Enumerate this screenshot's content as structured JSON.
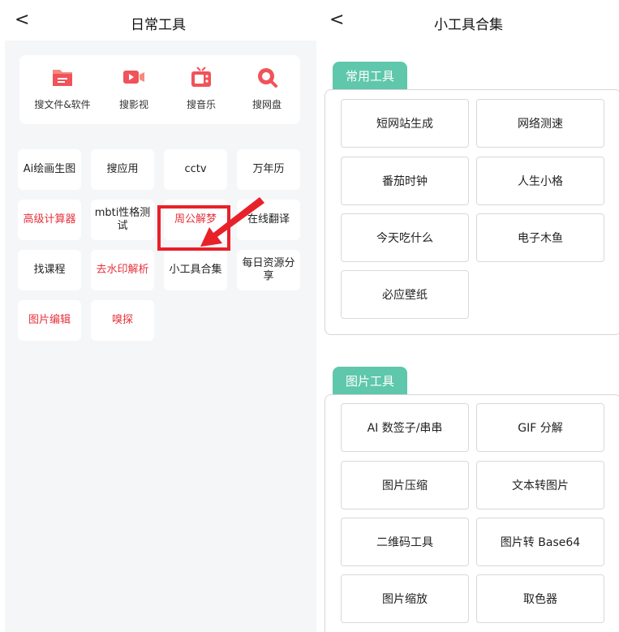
{
  "left": {
    "back": "<",
    "title": "日常工具",
    "search": [
      {
        "label": "搜文件&软件",
        "icon": "folder-icon"
      },
      {
        "label": "搜影视",
        "icon": "video-camera-icon"
      },
      {
        "label": "搜音乐",
        "icon": "tv-icon"
      },
      {
        "label": "搜网盘",
        "icon": "search-magnifier-icon"
      }
    ],
    "tools": [
      {
        "label": "Ai绘画生图"
      },
      {
        "label": "搜应用"
      },
      {
        "label": "cctv"
      },
      {
        "label": "万年历"
      },
      {
        "label": "高级计算器"
      },
      {
        "label": "mbti性格测试"
      },
      {
        "label": "周公解梦"
      },
      {
        "label": "在线翻译"
      },
      {
        "label": "找课程"
      },
      {
        "label": "去水印解析"
      },
      {
        "label": "小工具合集"
      },
      {
        "label": "每日资源分享"
      },
      {
        "label": "图片编辑"
      },
      {
        "label": "嗅探"
      }
    ],
    "highlight_color": "#e8202a"
  },
  "right": {
    "back": "<",
    "title": "小工具合集",
    "sections": [
      {
        "tag": "常用工具",
        "tools": [
          "短网站生成",
          "网络测速",
          "番茄时钟",
          "人生小格",
          "今天吃什么",
          "电子木鱼",
          "必应壁纸"
        ]
      },
      {
        "tag": "图片工具",
        "tools": [
          "AI 数签子/串串",
          "GIF 分解",
          "图片压缩",
          "文本转图片",
          "二维码工具",
          "图片转 Base64",
          "图片缩放",
          "取色器"
        ]
      }
    ],
    "accent": "#5fc7ab"
  },
  "colors": {
    "red_text": "#e6323c",
    "icon_red": "#f0535a",
    "icon_pink": "#f07a6e"
  }
}
